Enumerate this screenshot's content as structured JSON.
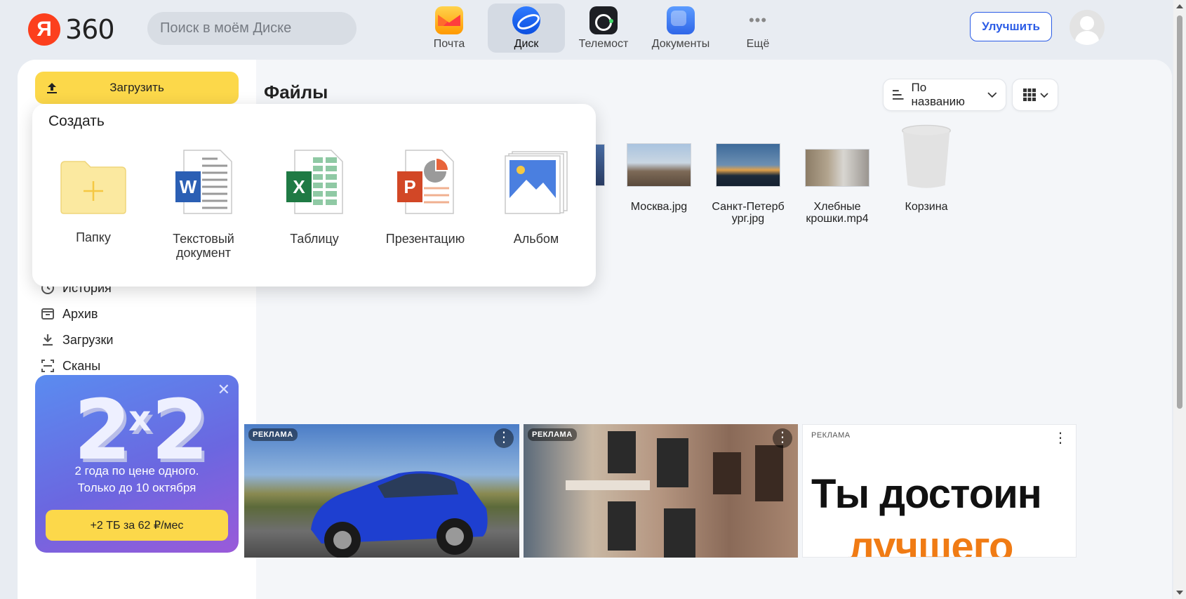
{
  "brand": {
    "logo_letter": "Я",
    "logo_text": "360"
  },
  "search": {
    "placeholder": "Поиск в моём Диске"
  },
  "services": [
    {
      "label": "Почта",
      "icon": "mail-icon"
    },
    {
      "label": "Диск",
      "icon": "disk-icon",
      "active": true
    },
    {
      "label": "Телемост",
      "icon": "telemost-icon"
    },
    {
      "label": "Документы",
      "icon": "docs-icon"
    },
    {
      "label": "Ещё",
      "icon": "more-icon"
    }
  ],
  "header": {
    "upgrade_label": "Улучшить"
  },
  "sidebar": {
    "upload_label": "Загрузить",
    "items": [
      {
        "label": "История",
        "icon": "history-icon"
      },
      {
        "label": "Архив",
        "icon": "archive-icon"
      },
      {
        "label": "Загрузки",
        "icon": "download-icon"
      },
      {
        "label": "Сканы",
        "icon": "scan-icon"
      }
    ]
  },
  "promo": {
    "big_left": "2",
    "big_sup": "x",
    "big_right": "2",
    "line1": "2 года по цене одного.",
    "line2": "Только до 10 октября",
    "button_label": "+2 ТБ  за 62 ₽/мес"
  },
  "main": {
    "title": "Файлы",
    "sort_label": "По названию",
    "files": [
      {
        "name": "Москва.jpg"
      },
      {
        "name": "Санкт-Петерб\nург.jpg"
      },
      {
        "name": "Хлебные\nкрошки.mp4"
      },
      {
        "name": "Корзина"
      }
    ]
  },
  "create_popup": {
    "title": "Создать",
    "items": [
      {
        "label": "Папку",
        "icon": "folder-plus-icon"
      },
      {
        "label": "Текстовый\nдокумент",
        "icon": "word-icon"
      },
      {
        "label": "Таблицу",
        "icon": "excel-icon"
      },
      {
        "label": "Презентацию",
        "icon": "powerpoint-icon"
      },
      {
        "label": "Альбом",
        "icon": "album-icon"
      }
    ]
  },
  "ads": [
    {
      "tag": "РЕКЛАМА"
    },
    {
      "tag": "РЕКЛАМА"
    },
    {
      "tag": "РЕКЛАМА",
      "headline1": "Ты достоин",
      "headline2": "лучшего"
    }
  ],
  "colors": {
    "accent_yellow": "#fcd84a",
    "link_blue": "#2b5ce6",
    "orange": "#f07b14"
  }
}
